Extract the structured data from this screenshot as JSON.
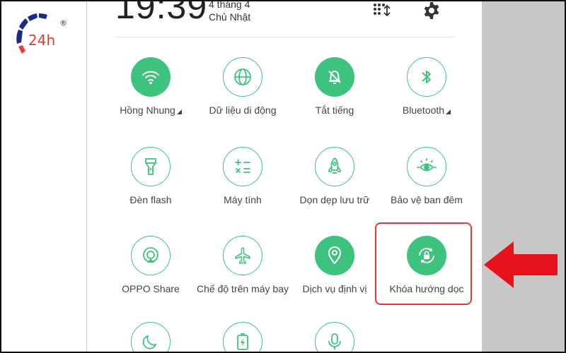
{
  "header": {
    "time": "19:39",
    "date_line1": "4 tháng 4",
    "date_line2": "Chủ Nhật"
  },
  "watermark": {
    "brand": "24h",
    "registered": "®"
  },
  "tiles": [
    {
      "id": "wifi",
      "label": "Hồng Nhung",
      "active": true,
      "dropdown": true,
      "icon": "wifi-icon"
    },
    {
      "id": "mobile-data",
      "label": "Dữ liệu di động",
      "active": false,
      "dropdown": false,
      "icon": "globe-icon"
    },
    {
      "id": "silent",
      "label": "Tắt tiếng",
      "active": true,
      "dropdown": false,
      "icon": "bell-off-icon"
    },
    {
      "id": "bluetooth",
      "label": "Bluetooth",
      "active": false,
      "dropdown": true,
      "icon": "bluetooth-icon"
    },
    {
      "id": "flashlight",
      "label": "Đèn flash",
      "active": false,
      "dropdown": false,
      "icon": "flashlight-icon"
    },
    {
      "id": "calculator",
      "label": "Máy tính",
      "active": false,
      "dropdown": false,
      "icon": "calculator-icon"
    },
    {
      "id": "clean-storage",
      "label": "Dọn dẹp lưu trữ",
      "active": false,
      "dropdown": false,
      "icon": "rocket-icon"
    },
    {
      "id": "night-shield",
      "label": "Bảo vệ ban đêm",
      "active": false,
      "dropdown": false,
      "icon": "eye-icon"
    },
    {
      "id": "oppo-share",
      "label": "OPPO Share",
      "active": false,
      "dropdown": false,
      "icon": "share-icon"
    },
    {
      "id": "airplane",
      "label": "Chế độ trên máy bay",
      "active": false,
      "dropdown": false,
      "icon": "airplane-icon"
    },
    {
      "id": "location",
      "label": "Dịch vụ định vị",
      "active": true,
      "dropdown": false,
      "icon": "location-icon"
    },
    {
      "id": "rotation-lock",
      "label": "Khóa hướng dọc",
      "active": true,
      "dropdown": false,
      "icon": "rotation-lock-icon"
    },
    {
      "id": "dark-mode",
      "label": "",
      "active": false,
      "dropdown": false,
      "icon": "moon-icon"
    },
    {
      "id": "battery-saver",
      "label": "",
      "active": false,
      "dropdown": false,
      "icon": "battery-icon"
    },
    {
      "id": "voice",
      "label": "",
      "active": false,
      "dropdown": false,
      "icon": "microphone-icon"
    }
  ],
  "colors": {
    "accent": "#3ec37f",
    "highlight": "#e53935",
    "arrow": "#e8121c",
    "side_gray": "#c7c7c7"
  }
}
